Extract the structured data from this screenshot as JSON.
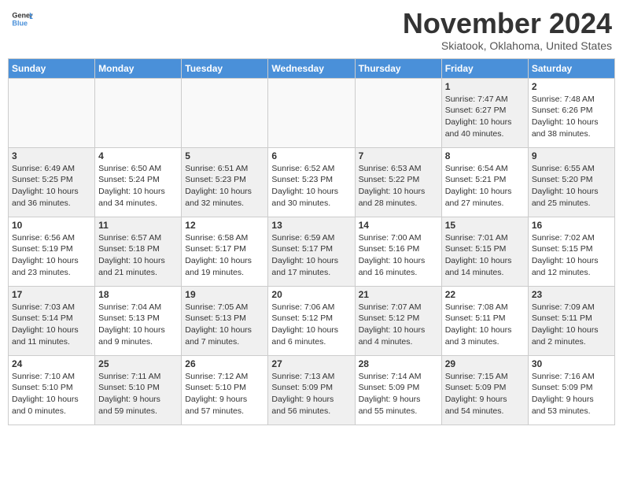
{
  "header": {
    "logo_general": "General",
    "logo_blue": "Blue",
    "month": "November 2024",
    "location": "Skiatook, Oklahoma, United States"
  },
  "weekdays": [
    "Sunday",
    "Monday",
    "Tuesday",
    "Wednesday",
    "Thursday",
    "Friday",
    "Saturday"
  ],
  "weeks": [
    [
      {
        "day": "",
        "info": "",
        "empty": true
      },
      {
        "day": "",
        "info": "",
        "empty": true
      },
      {
        "day": "",
        "info": "",
        "empty": true
      },
      {
        "day": "",
        "info": "",
        "empty": true
      },
      {
        "day": "",
        "info": "",
        "empty": true
      },
      {
        "day": "1",
        "info": "Sunrise: 7:47 AM\nSunset: 6:27 PM\nDaylight: 10 hours\nand 40 minutes.",
        "shaded": true
      },
      {
        "day": "2",
        "info": "Sunrise: 7:48 AM\nSunset: 6:26 PM\nDaylight: 10 hours\nand 38 minutes.",
        "shaded": false
      }
    ],
    [
      {
        "day": "3",
        "info": "Sunrise: 6:49 AM\nSunset: 5:25 PM\nDaylight: 10 hours\nand 36 minutes.",
        "shaded": true
      },
      {
        "day": "4",
        "info": "Sunrise: 6:50 AM\nSunset: 5:24 PM\nDaylight: 10 hours\nand 34 minutes.",
        "shaded": false
      },
      {
        "day": "5",
        "info": "Sunrise: 6:51 AM\nSunset: 5:23 PM\nDaylight: 10 hours\nand 32 minutes.",
        "shaded": true
      },
      {
        "day": "6",
        "info": "Sunrise: 6:52 AM\nSunset: 5:23 PM\nDaylight: 10 hours\nand 30 minutes.",
        "shaded": false
      },
      {
        "day": "7",
        "info": "Sunrise: 6:53 AM\nSunset: 5:22 PM\nDaylight: 10 hours\nand 28 minutes.",
        "shaded": true
      },
      {
        "day": "8",
        "info": "Sunrise: 6:54 AM\nSunset: 5:21 PM\nDaylight: 10 hours\nand 27 minutes.",
        "shaded": false
      },
      {
        "day": "9",
        "info": "Sunrise: 6:55 AM\nSunset: 5:20 PM\nDaylight: 10 hours\nand 25 minutes.",
        "shaded": true
      }
    ],
    [
      {
        "day": "10",
        "info": "Sunrise: 6:56 AM\nSunset: 5:19 PM\nDaylight: 10 hours\nand 23 minutes.",
        "shaded": false
      },
      {
        "day": "11",
        "info": "Sunrise: 6:57 AM\nSunset: 5:18 PM\nDaylight: 10 hours\nand 21 minutes.",
        "shaded": true
      },
      {
        "day": "12",
        "info": "Sunrise: 6:58 AM\nSunset: 5:17 PM\nDaylight: 10 hours\nand 19 minutes.",
        "shaded": false
      },
      {
        "day": "13",
        "info": "Sunrise: 6:59 AM\nSunset: 5:17 PM\nDaylight: 10 hours\nand 17 minutes.",
        "shaded": true
      },
      {
        "day": "14",
        "info": "Sunrise: 7:00 AM\nSunset: 5:16 PM\nDaylight: 10 hours\nand 16 minutes.",
        "shaded": false
      },
      {
        "day": "15",
        "info": "Sunrise: 7:01 AM\nSunset: 5:15 PM\nDaylight: 10 hours\nand 14 minutes.",
        "shaded": true
      },
      {
        "day": "16",
        "info": "Sunrise: 7:02 AM\nSunset: 5:15 PM\nDaylight: 10 hours\nand 12 minutes.",
        "shaded": false
      }
    ],
    [
      {
        "day": "17",
        "info": "Sunrise: 7:03 AM\nSunset: 5:14 PM\nDaylight: 10 hours\nand 11 minutes.",
        "shaded": true
      },
      {
        "day": "18",
        "info": "Sunrise: 7:04 AM\nSunset: 5:13 PM\nDaylight: 10 hours\nand 9 minutes.",
        "shaded": false
      },
      {
        "day": "19",
        "info": "Sunrise: 7:05 AM\nSunset: 5:13 PM\nDaylight: 10 hours\nand 7 minutes.",
        "shaded": true
      },
      {
        "day": "20",
        "info": "Sunrise: 7:06 AM\nSunset: 5:12 PM\nDaylight: 10 hours\nand 6 minutes.",
        "shaded": false
      },
      {
        "day": "21",
        "info": "Sunrise: 7:07 AM\nSunset: 5:12 PM\nDaylight: 10 hours\nand 4 minutes.",
        "shaded": true
      },
      {
        "day": "22",
        "info": "Sunrise: 7:08 AM\nSunset: 5:11 PM\nDaylight: 10 hours\nand 3 minutes.",
        "shaded": false
      },
      {
        "day": "23",
        "info": "Sunrise: 7:09 AM\nSunset: 5:11 PM\nDaylight: 10 hours\nand 2 minutes.",
        "shaded": true
      }
    ],
    [
      {
        "day": "24",
        "info": "Sunrise: 7:10 AM\nSunset: 5:10 PM\nDaylight: 10 hours\nand 0 minutes.",
        "shaded": false
      },
      {
        "day": "25",
        "info": "Sunrise: 7:11 AM\nSunset: 5:10 PM\nDaylight: 9 hours\nand 59 minutes.",
        "shaded": true
      },
      {
        "day": "26",
        "info": "Sunrise: 7:12 AM\nSunset: 5:10 PM\nDaylight: 9 hours\nand 57 minutes.",
        "shaded": false
      },
      {
        "day": "27",
        "info": "Sunrise: 7:13 AM\nSunset: 5:09 PM\nDaylight: 9 hours\nand 56 minutes.",
        "shaded": true
      },
      {
        "day": "28",
        "info": "Sunrise: 7:14 AM\nSunset: 5:09 PM\nDaylight: 9 hours\nand 55 minutes.",
        "shaded": false
      },
      {
        "day": "29",
        "info": "Sunrise: 7:15 AM\nSunset: 5:09 PM\nDaylight: 9 hours\nand 54 minutes.",
        "shaded": true
      },
      {
        "day": "30",
        "info": "Sunrise: 7:16 AM\nSunset: 5:09 PM\nDaylight: 9 hours\nand 53 minutes.",
        "shaded": false
      }
    ]
  ]
}
